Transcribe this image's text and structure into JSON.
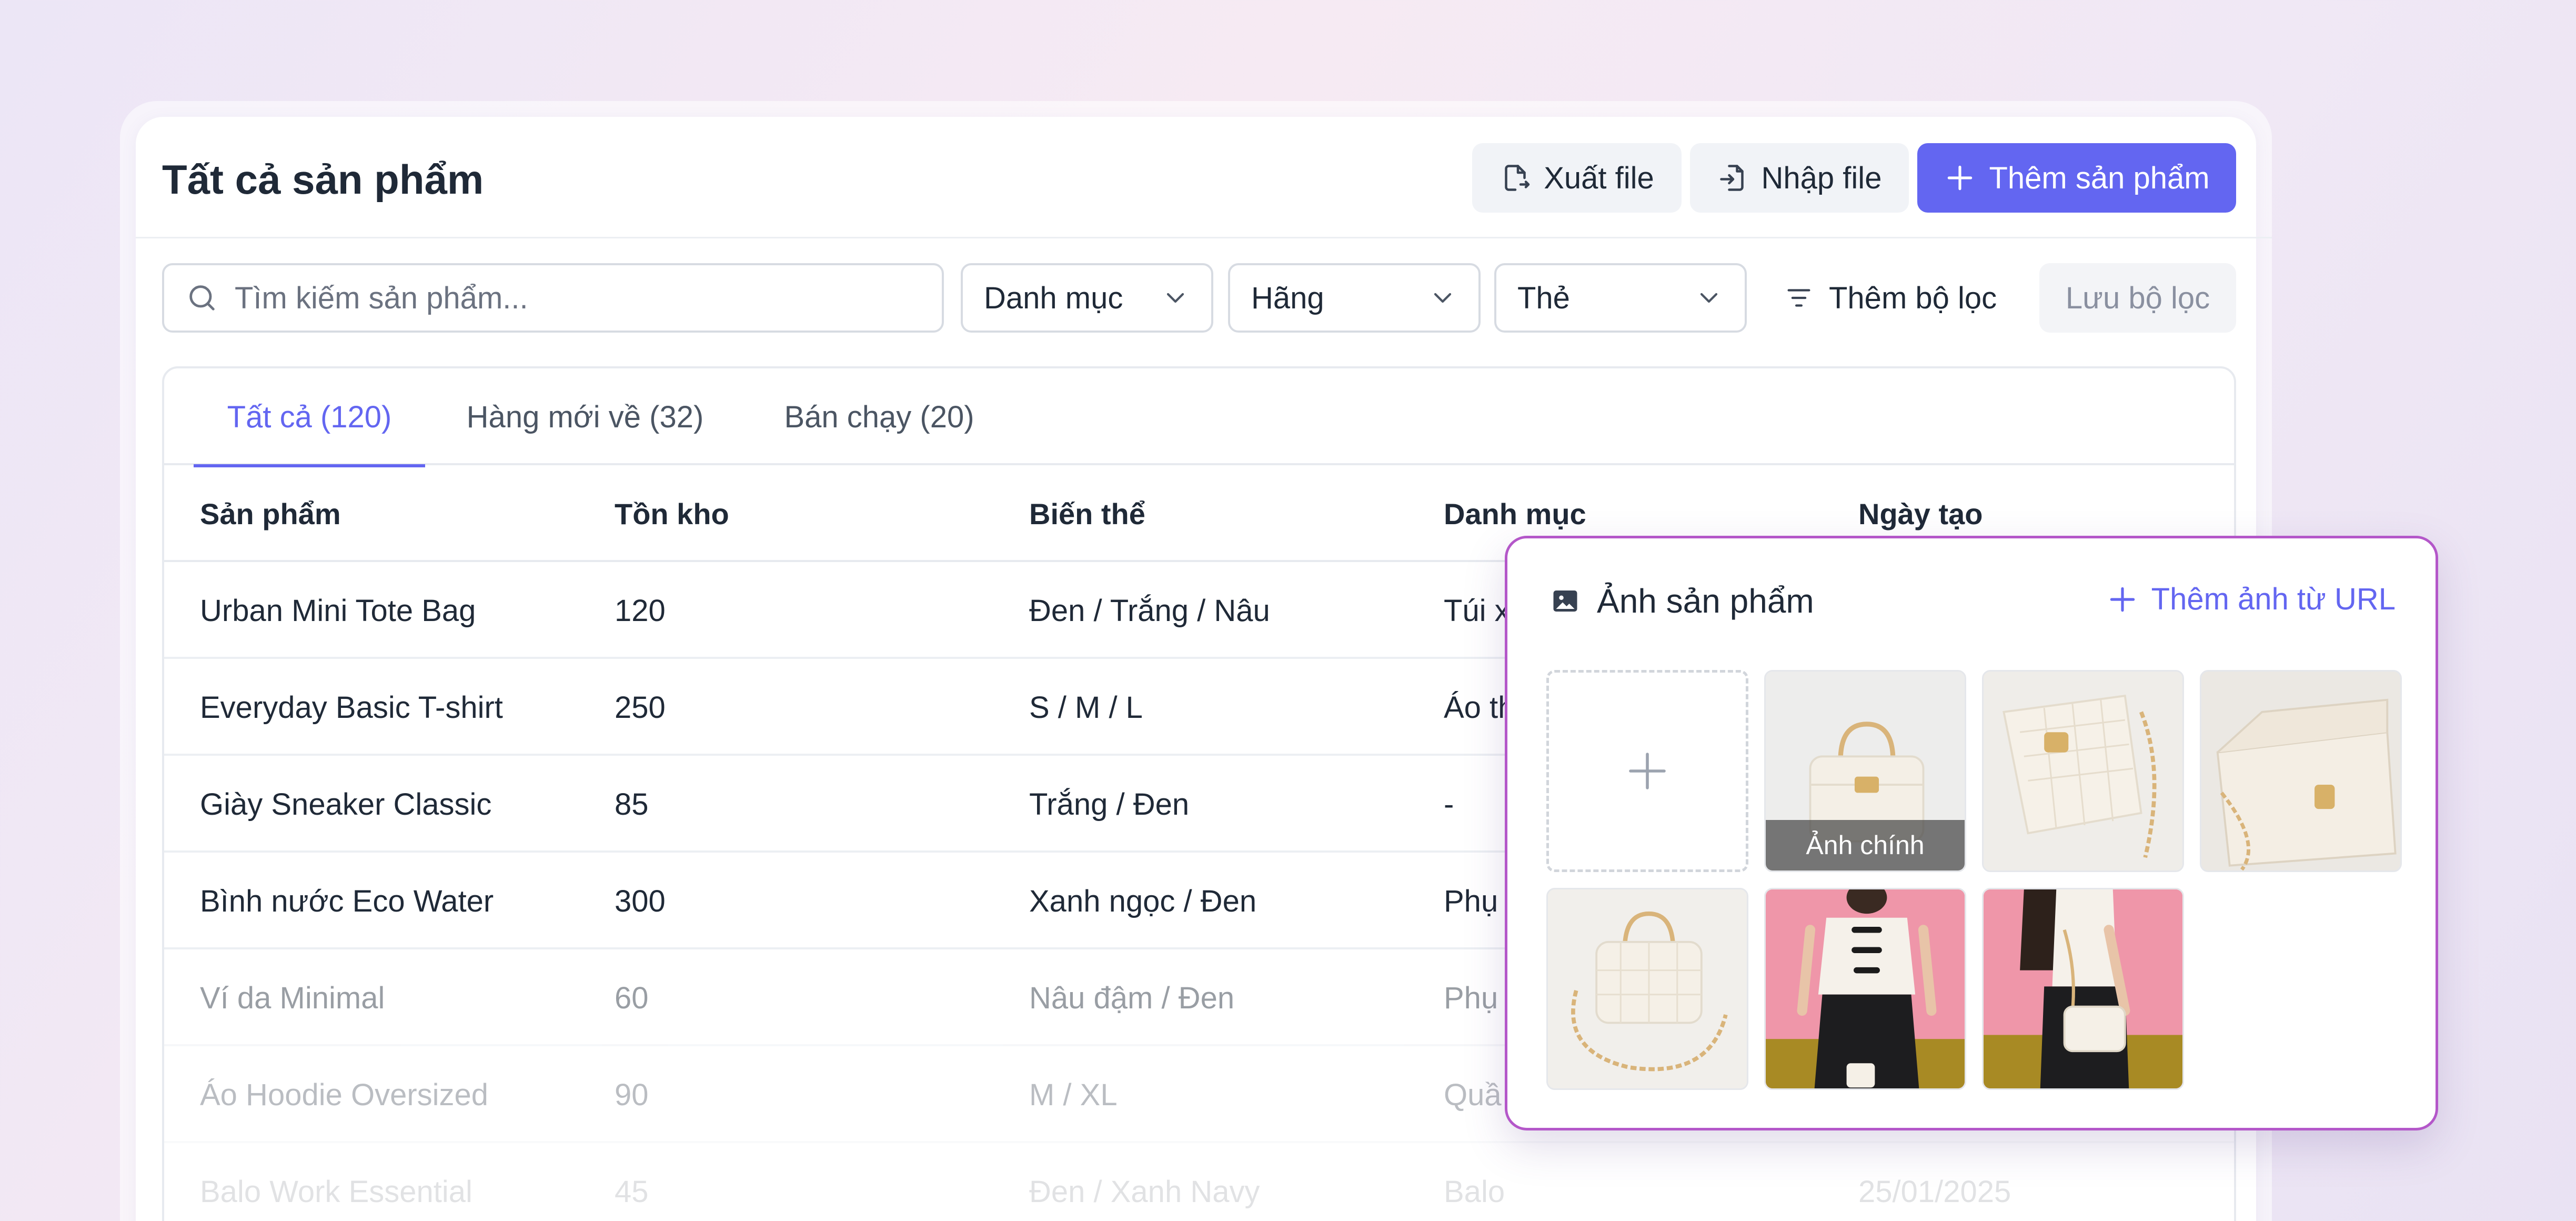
{
  "header": {
    "title": "Tất cả sản phẩm",
    "export_label": "Xuất file",
    "import_label": "Nhập file",
    "add_label": "Thêm sản phẩm"
  },
  "filters": {
    "search_placeholder": "Tìm kiếm sản phẩm...",
    "category": "Danh mục",
    "brand": "Hãng",
    "tag": "Thẻ",
    "add_filter": "Thêm bộ lọc",
    "save_filter": "Lưu bộ lọc"
  },
  "tabs": [
    {
      "label": "Tất cả (120)"
    },
    {
      "label": "Hàng mới về (32)"
    },
    {
      "label": "Bán chạy (20)"
    }
  ],
  "columns": [
    "Sản phẩm",
    "Tồn kho",
    "Biến thể",
    "Danh mục",
    "Ngày tạo"
  ],
  "rows": [
    {
      "name": "Urban Mini Tote Bag",
      "stock": "120",
      "variant": "Đen / Trắng / Nâu",
      "category": "Túi x",
      "opacity": 1
    },
    {
      "name": "Everyday Basic T-shirt",
      "stock": "250",
      "variant": "S / M / L",
      "category": "Áo th",
      "opacity": 1
    },
    {
      "name": "Giày Sneaker Classic",
      "stock": "85",
      "variant": "Trắng / Đen",
      "category": "-",
      "opacity": 1
    },
    {
      "name": "Bình nước Eco Water",
      "stock": "300",
      "variant": "Xanh ngọc / Đen",
      "category": "Phụ",
      "opacity": 1
    },
    {
      "name": "Ví da Minimal",
      "stock": "60",
      "variant": "Nâu đậm / Đen",
      "category": "Phụ",
      "opacity": 0.45
    },
    {
      "name": "Áo Hoodie Oversized",
      "stock": "90",
      "variant": "M / XL",
      "category": "Quầ",
      "opacity": 0.3
    },
    {
      "name": "Balo Work Essential",
      "stock": "45",
      "variant": "Đen / Xanh Navy",
      "category": "Balo",
      "date": "25/01/2025",
      "opacity": 0.13
    }
  ],
  "popup": {
    "title": "Ảnh sản phẩm",
    "add_url": "Thêm ảnh từ URL",
    "main_label": "Ảnh chính"
  },
  "colors": {
    "primary": "#6366f1",
    "popup_border": "#b457c9"
  }
}
